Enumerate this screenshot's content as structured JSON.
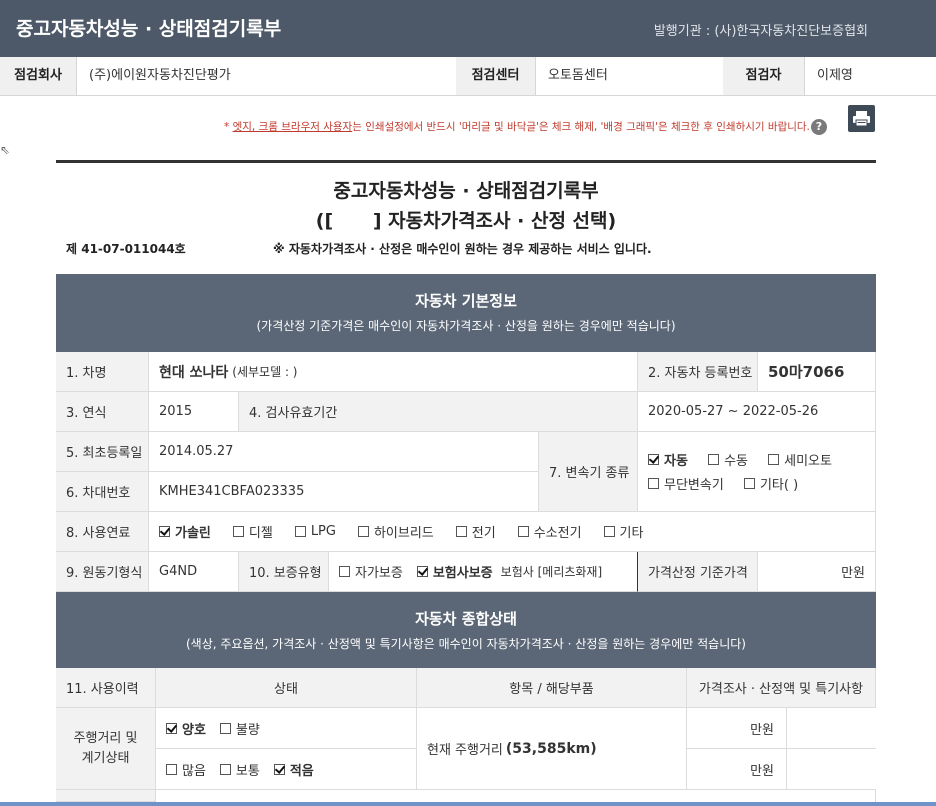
{
  "header": {
    "title": "중고자동차성능 · 상태점검기록부",
    "issuer": "발행기관 : (사)한국자동차진단보증협회"
  },
  "info": {
    "company_label": "점검회사",
    "company_value": "(주)에이원자동차진단평가",
    "center_label": "점검센터",
    "center_value": "오토돔센터",
    "inspector_label": "점검자",
    "inspector_value": "이제영"
  },
  "notice": {
    "prefix": "* ",
    "underlined": "엣지, 크롬 브라우저 사용자",
    "rest": "는 인쇄설정에서 반드시 '머리글 및 바닥글'은 체크 해제, '배경 그래픽'은 체크한 후 인쇄하시기 바랍니다.",
    "help": "?"
  },
  "doc": {
    "title1": "중고자동차성능 · 상태점검기록부",
    "title2": "([      ] 자동차가격조사 · 산정 선택)",
    "number": "제 41-07-011044호",
    "note": "※ 자동차가격조사 · 산정은 매수인이 원하는 경우 제공하는 서비스 입니다."
  },
  "basic": {
    "heading": "자동차 기본정보",
    "sub": "(가격산정 기준가격은 매수인이 자동차가격조사 · 산정을 원하는 경우에만 적습니다)",
    "car_name_label": "1. 차명",
    "car_name_value": "현대 쏘나타",
    "car_name_detail": "(세부모델 : )",
    "reg_no_label": "2. 자동차 등록번호",
    "reg_no_value": "50마7066",
    "year_label": "3. 연식",
    "year_value": "2015",
    "valid_label": "4. 검사유효기간",
    "valid_value": "2020-05-27 ~ 2022-05-26",
    "first_reg_label": "5. 최초등록일",
    "first_reg_value": "2014.05.27",
    "trans_label": "7. 변속기 종류",
    "trans_options": [
      {
        "label": "자동",
        "checked": true
      },
      {
        "label": "수동",
        "checked": false
      },
      {
        "label": "세미오토",
        "checked": false
      },
      {
        "label": "무단변속기",
        "checked": false
      },
      {
        "label": "기타( )",
        "checked": false
      }
    ],
    "vin_label": "6. 차대번호",
    "vin_value": "KMHE341CBFA023335",
    "fuel_label": "8. 사용연료",
    "fuel_options": [
      {
        "label": "가솔린",
        "checked": true
      },
      {
        "label": "디젤",
        "checked": false
      },
      {
        "label": "LPG",
        "checked": false
      },
      {
        "label": "하이브리드",
        "checked": false
      },
      {
        "label": "전기",
        "checked": false
      },
      {
        "label": "수소전기",
        "checked": false
      },
      {
        "label": "기타",
        "checked": false
      }
    ],
    "engine_label": "9. 원동기형식",
    "engine_value": "G4ND",
    "warranty_label": "10. 보증유형",
    "warranty_options": [
      {
        "label": "자가보증",
        "checked": false
      },
      {
        "label": "보험사보증",
        "checked": true
      }
    ],
    "insurer_text": "보험사 [메리츠화재]",
    "price_label": "가격산정 기준가격",
    "price_unit": "만원"
  },
  "status": {
    "heading": "자동차 종합상태",
    "sub": "(색상, 주요옵션, 가격조사 · 산정액 및 특기사항은 매수인이 자동차가격조사 · 산정을 원하는 경우에만 적습니다)",
    "col_history": "11. 사용이력",
    "col_state": "상태",
    "col_item": "항목 / 해당부품",
    "col_price": "가격조사 · 산정액 및 특기사항",
    "row_label_line1": "주행거리 및",
    "row_label_line2": "계기상태",
    "cond_options": [
      {
        "label": "양호",
        "checked": true
      },
      {
        "label": "불량",
        "checked": false
      }
    ],
    "amount_options": [
      {
        "label": "많음",
        "checked": false
      },
      {
        "label": "보통",
        "checked": false
      },
      {
        "label": "적음",
        "checked": true
      }
    ],
    "mileage_prefix": "현재 주행거리",
    "mileage_value": "(53,585km)",
    "unit1": "만원",
    "unit2": "만원"
  }
}
